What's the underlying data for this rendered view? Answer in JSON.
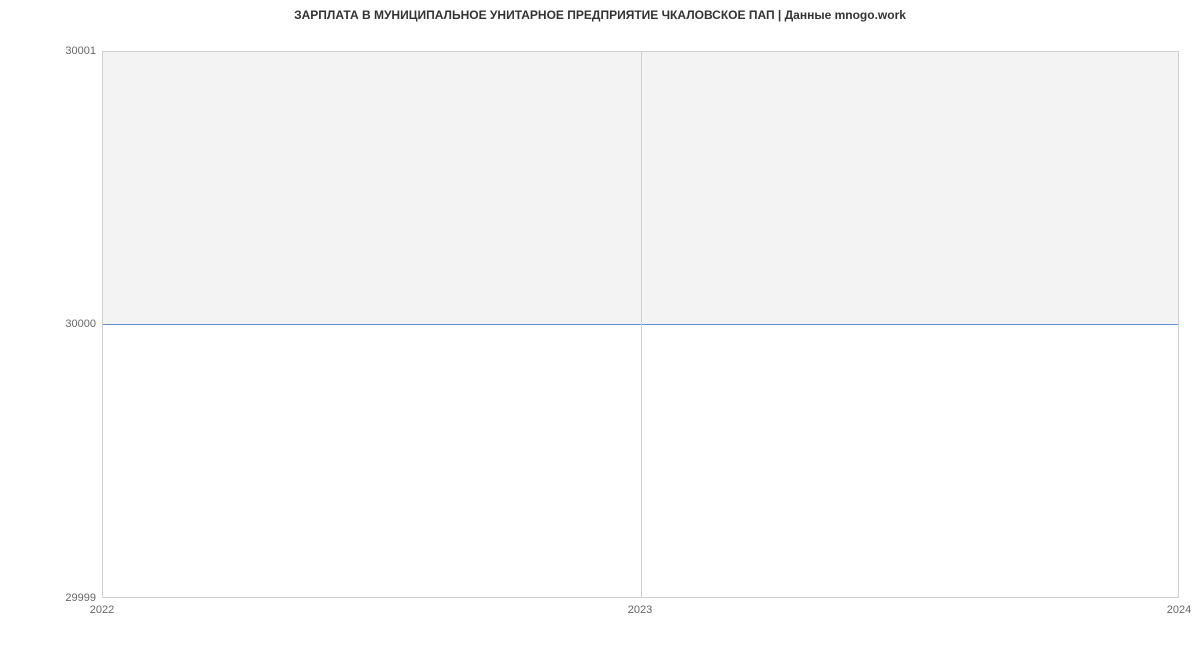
{
  "chart_data": {
    "type": "area",
    "title": "ЗАРПЛАТА В МУНИЦИПАЛЬНОЕ УНИТАРНОЕ ПРЕДПРИЯТИЕ ЧКАЛОВСКОЕ ПАП | Данные mnogo.work",
    "x": [
      2022,
      2023,
      2024
    ],
    "values": [
      30000,
      30000,
      30000
    ],
    "xlabel": "",
    "ylabel": "",
    "x_ticks": [
      "2022",
      "2023",
      "2024"
    ],
    "y_ticks": [
      "29999",
      "30000",
      "30001"
    ],
    "xlim": [
      2022,
      2024
    ],
    "ylim": [
      29999,
      30001
    ],
    "colors": {
      "line": "#5b8fd6",
      "fill": "#f3f3f3",
      "axis": "#cfcfcf"
    }
  }
}
